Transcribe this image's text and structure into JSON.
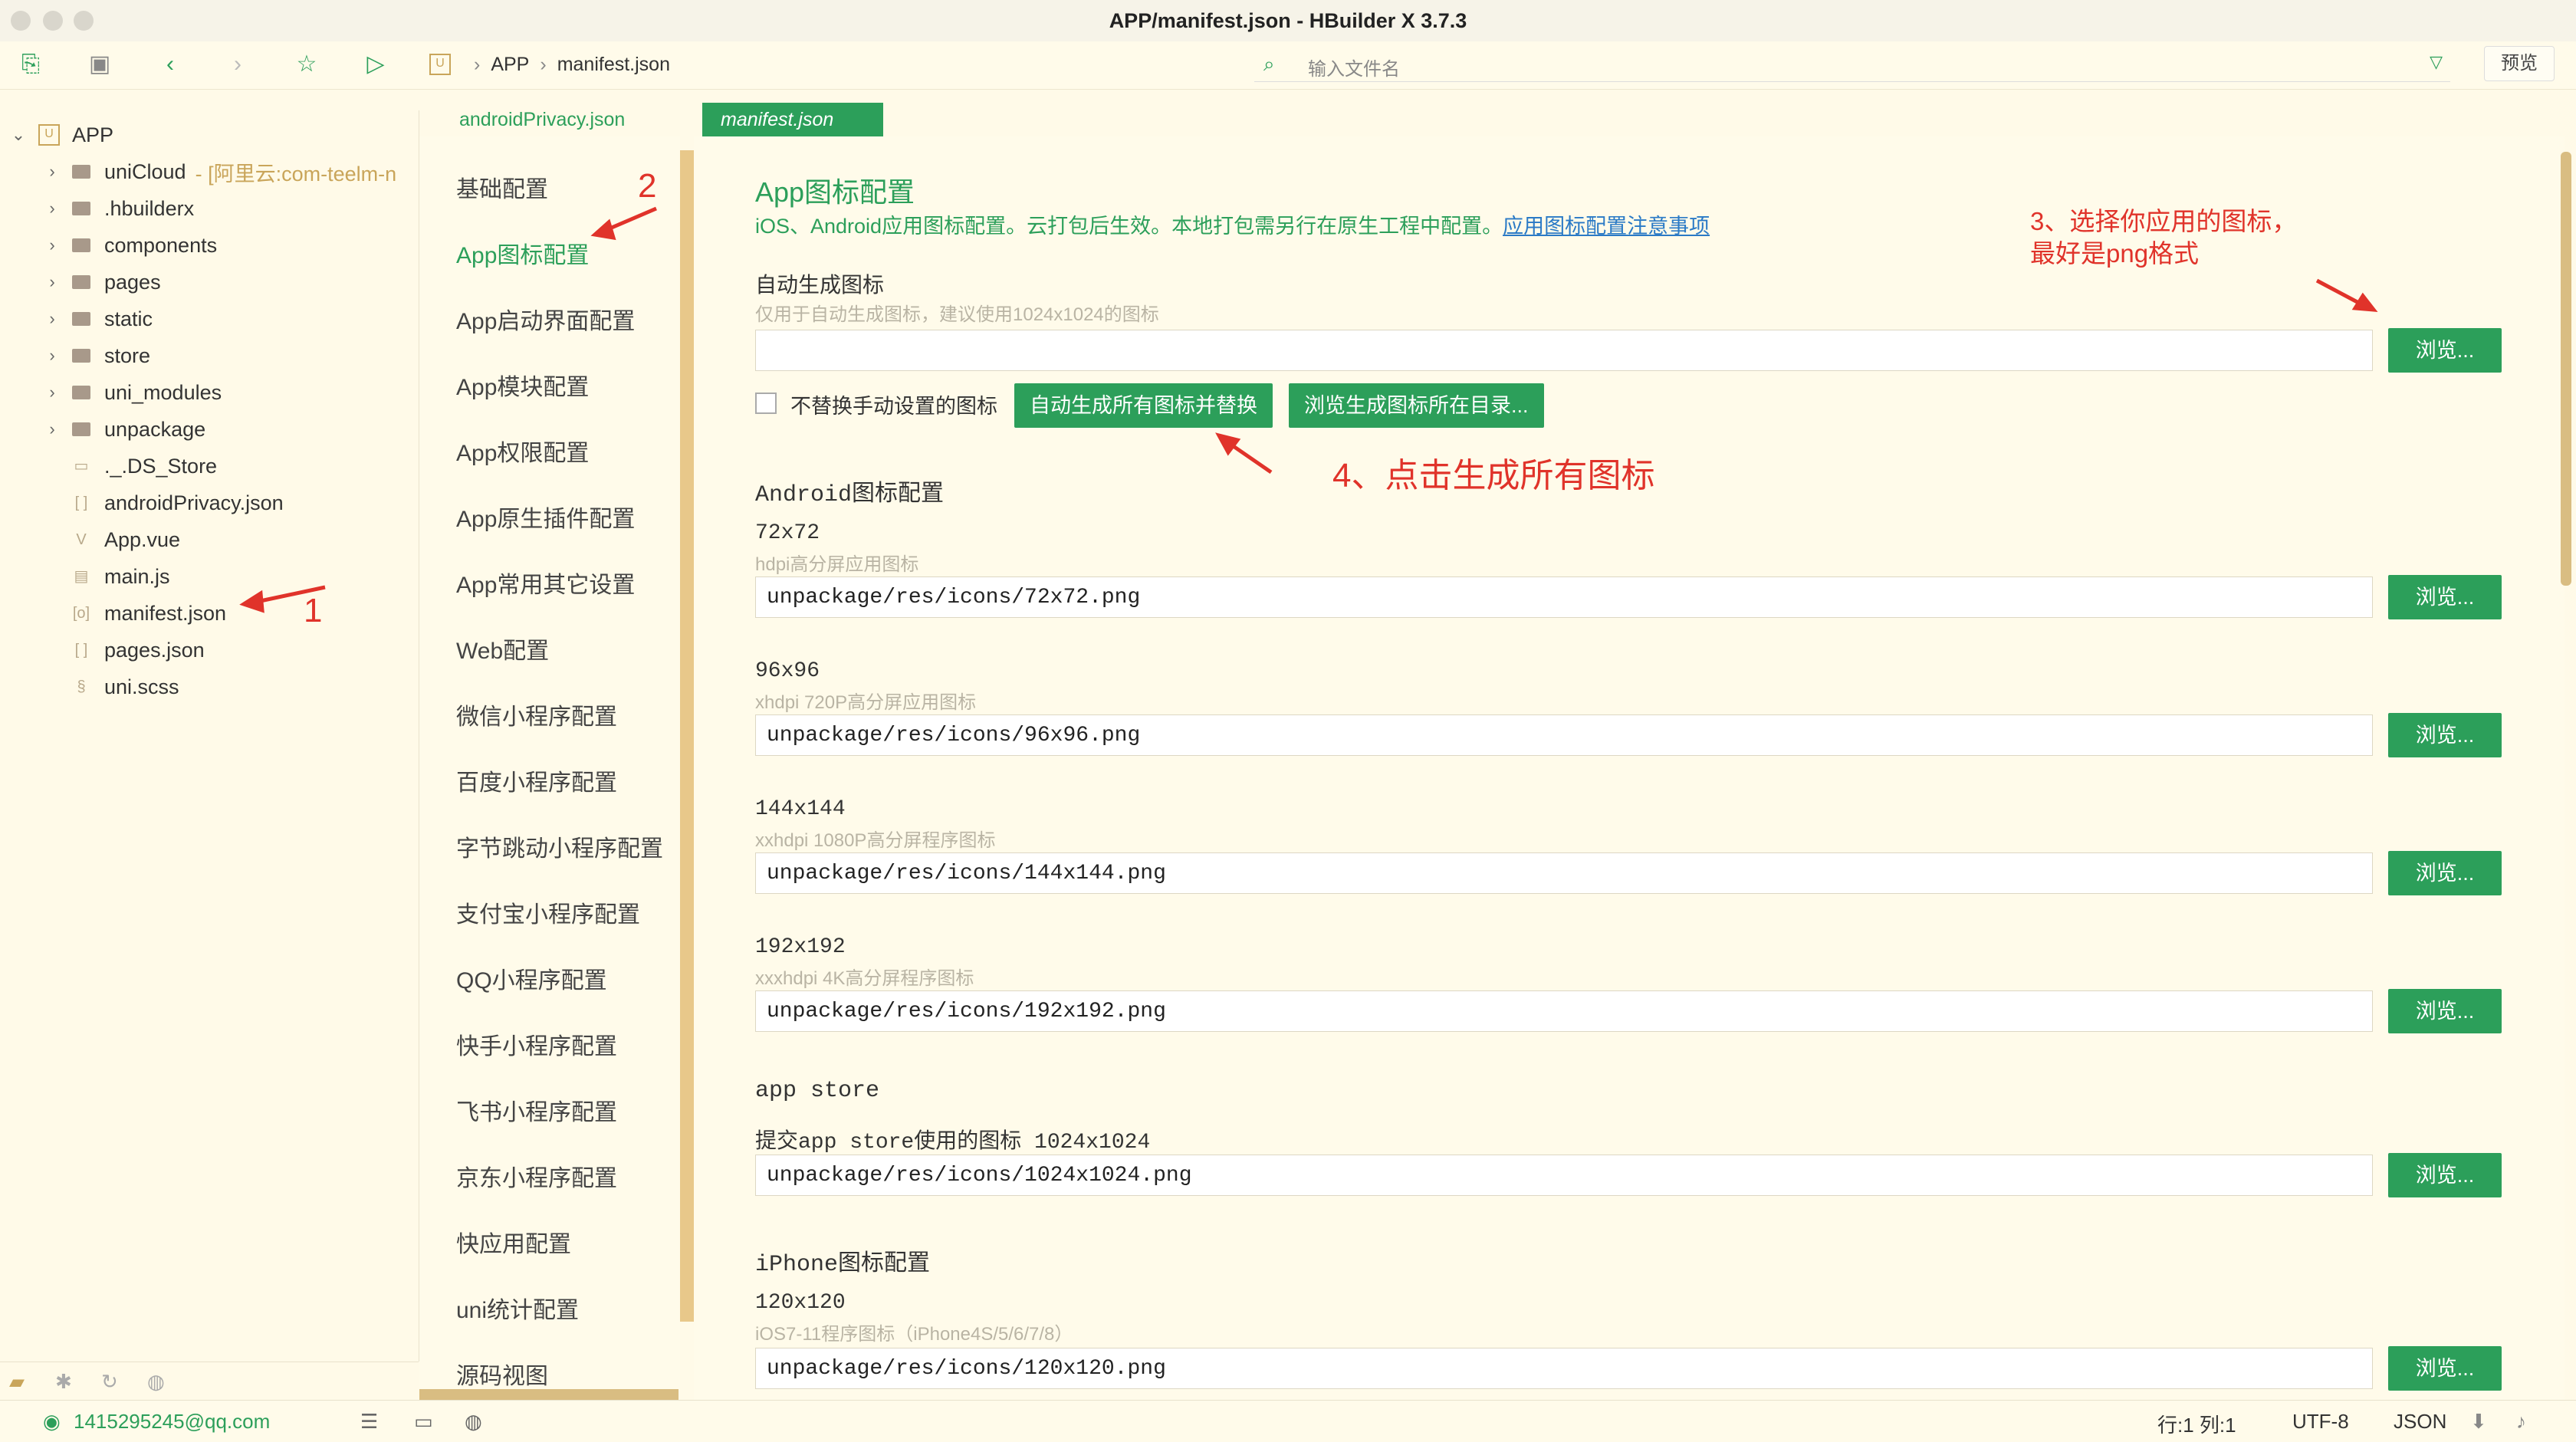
{
  "window": {
    "title": "APP/manifest.json - HBuilder X 3.7.3"
  },
  "toolbar": {
    "icons": [
      "new-file-icon",
      "save-icon",
      "back-icon",
      "forward-icon",
      "star-icon",
      "run-icon"
    ],
    "breadcrumb": [
      "APP",
      "manifest.json"
    ],
    "search_placeholder": "输入文件名",
    "preview_label": "预览"
  },
  "sidebar": {
    "root": "APP",
    "items": [
      {
        "label": "uniCloud",
        "extra": "- [阿里云:com-teelm-n",
        "type": "folder"
      },
      {
        "label": ".hbuilderx",
        "type": "folder"
      },
      {
        "label": "components",
        "type": "folder"
      },
      {
        "label": "pages",
        "type": "folder"
      },
      {
        "label": "static",
        "type": "folder"
      },
      {
        "label": "store",
        "type": "folder"
      },
      {
        "label": "uni_modules",
        "type": "folder"
      },
      {
        "label": "unpackage",
        "type": "folder"
      },
      {
        "label": "._.DS_Store",
        "type": "file"
      },
      {
        "label": "androidPrivacy.json",
        "type": "json"
      },
      {
        "label": "App.vue",
        "type": "vue"
      },
      {
        "label": "main.js",
        "type": "js"
      },
      {
        "label": "manifest.json",
        "type": "json"
      },
      {
        "label": "pages.json",
        "type": "json"
      },
      {
        "label": "uni.scss",
        "type": "scss"
      }
    ]
  },
  "tabs": [
    "androidPrivacy.json",
    "manifest.json"
  ],
  "nav": {
    "items": [
      "基础配置",
      "App图标配置",
      "App启动界面配置",
      "App模块配置",
      "App权限配置",
      "App原生插件配置",
      "App常用其它设置",
      "Web配置",
      "微信小程序配置",
      "百度小程序配置",
      "字节跳动小程序配置",
      "支付宝小程序配置",
      "QQ小程序配置",
      "快手小程序配置",
      "飞书小程序配置",
      "京东小程序配置",
      "快应用配置",
      "uni统计配置",
      "源码视图"
    ],
    "active_index": 1
  },
  "content": {
    "title": "App图标配置",
    "desc": "iOS、Android应用图标配置。云打包后生效。本地打包需另行在原生工程中配置。",
    "desc_link": "应用图标配置注意事项",
    "auto": {
      "label": "自动生成图标",
      "hint": "仅用于自动生成图标，建议使用1024x1024的图标",
      "value": "",
      "checkbox_label": "不替换手动设置的图标",
      "gen_button": "自动生成所有图标并替换",
      "dir_button": "浏览生成图标所在目录..."
    },
    "browse_label": "浏览...",
    "android_title": "Android图标配置",
    "android": [
      {
        "label": "72x72",
        "hint": "hdpi高分屏应用图标",
        "value": "unpackage/res/icons/72x72.png"
      },
      {
        "label": "96x96",
        "hint": "xhdpi 720P高分屏应用图标",
        "value": "unpackage/res/icons/96x96.png"
      },
      {
        "label": "144x144",
        "hint": "xxhdpi 1080P高分屏程序图标",
        "value": "unpackage/res/icons/144x144.png"
      },
      {
        "label": "192x192",
        "hint": "xxxhdpi 4K高分屏程序图标",
        "value": "unpackage/res/icons/192x192.png"
      }
    ],
    "appstore_title": "app store",
    "appstore": {
      "label": "提交app store使用的图标 1024x1024",
      "value": "unpackage/res/icons/1024x1024.png"
    },
    "iphone_title": "iPhone图标配置",
    "iphone": {
      "label": "120x120",
      "hint": "iOS7-11程序图标（iPhone4S/5/6/7/8）",
      "value": "unpackage/res/icons/120x120.png"
    }
  },
  "annotations": {
    "a1": "1",
    "a2": "2",
    "a3_line1": "3、选择你应用的图标，",
    "a3_line2": "最好是png格式",
    "a4": "4、点击生成所有图标"
  },
  "statusbar": {
    "user": "1415295245@qq.com",
    "position": "行:1  列:1",
    "encoding": "UTF-8",
    "language": "JSON"
  },
  "colors": {
    "accent": "#2c9f5a",
    "background": "#fffbea",
    "annotation": "#e0332a",
    "link": "#2a7ac6"
  }
}
